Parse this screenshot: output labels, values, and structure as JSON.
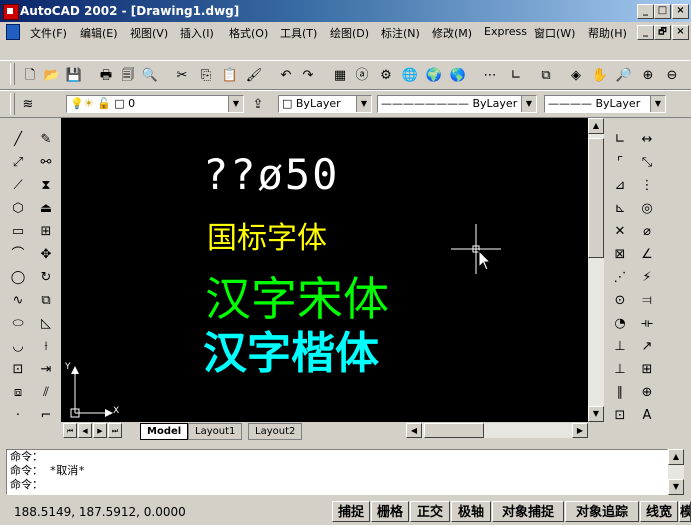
{
  "window": {
    "title": "AutoCAD 2002 - [Drawing1.dwg]",
    "min": "_",
    "max": "□",
    "close": "×",
    "child_min": "_",
    "child_restore": "🗗",
    "child_close": "×"
  },
  "menu": [
    "文件(F)",
    "编辑(E)",
    "视图(V)",
    "插入(I)",
    "格式(O)",
    "工具(T)",
    "绘图(D)",
    "标注(N)",
    "修改(M)",
    "Express",
    "窗口(W)",
    "帮助(H)"
  ],
  "layer": {
    "value": "0"
  },
  "properties": {
    "color": "ByLayer",
    "linetype": "ByLayer",
    "lineweight": "ByLayer"
  },
  "drawing": {
    "text1": "??ø50",
    "text1_color": "#ffffff",
    "text2": "国标字体",
    "text2_color": "#ffff00",
    "text3": "汉字宋体",
    "text3_color": "#00ff00",
    "text4": "汉字楷体",
    "text4_color": "#00ffff",
    "ucs_x": "X",
    "ucs_y": "Y"
  },
  "tabs": {
    "model": "Model",
    "layout1": "Layout1",
    "layout2": "Layout2"
  },
  "command": {
    "line1": "命令：",
    "line2": "命令： *取消*",
    "line3": "命令："
  },
  "status": {
    "coords": "188.5149, 187.5912, 0.0000",
    "buttons": [
      "捕捉",
      "栅格",
      "正交",
      "极轴",
      "对象捕捉",
      "对象追踪",
      "线宽",
      "模"
    ]
  }
}
